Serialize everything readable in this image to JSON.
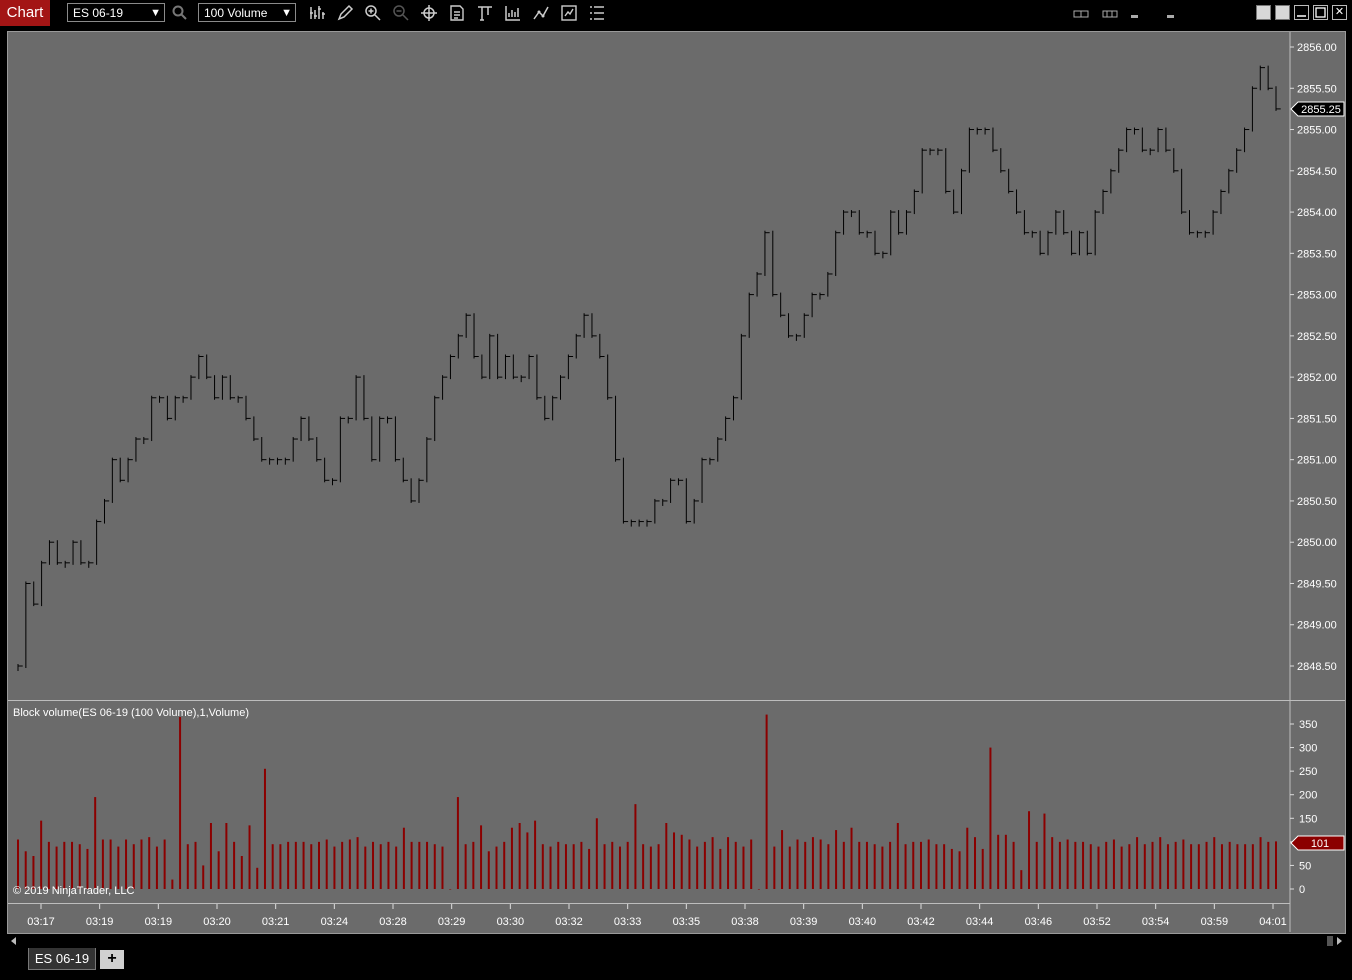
{
  "app": {
    "tab_label": "Chart"
  },
  "toolbar": {
    "instrument": "ES 06-19",
    "bar_type": "100 Volume",
    "icons": [
      "search-icon",
      "data-series-icon",
      "draw-tools-icon",
      "zoom-in-icon",
      "zoom-out-icon",
      "crosshair-icon",
      "chart-properties-icon",
      "bar-type-icon",
      "indicators-icon",
      "strategies-icon",
      "chart-trader-icon",
      "templates-icon"
    ]
  },
  "window_controls": {
    "close": "✕"
  },
  "price_panel": {
    "last_price_label": "2855.25",
    "y_axis_labels": [
      "2856.00",
      "2855.50",
      "2855.00",
      "2854.50",
      "2854.00",
      "2853.50",
      "2853.00",
      "2852.50",
      "2852.00",
      "2851.50",
      "2851.00",
      "2850.50",
      "2850.00",
      "2849.50",
      "2849.00",
      "2848.50"
    ]
  },
  "volume_panel": {
    "title": "Block volume(ES 06-19 (100 Volume),1,Volume)",
    "last_volume_label": "101",
    "y_axis_labels": [
      "350",
      "300",
      "250",
      "200",
      "150",
      "100",
      "50",
      "0"
    ]
  },
  "copyright": "© 2019 NinjaTrader, LLC",
  "x_axis_labels": [
    "03:17",
    "03:19",
    "03:19",
    "03:20",
    "03:21",
    "03:24",
    "03:28",
    "03:29",
    "03:30",
    "03:32",
    "03:33",
    "03:35",
    "03:38",
    "03:39",
    "03:40",
    "03:42",
    "03:44",
    "03:46",
    "03:52",
    "03:54",
    "03:59",
    "04:01"
  ],
  "colors": {
    "background": "#6b6b6b",
    "bar": "#000000",
    "volume": "#8b0000",
    "price_marker_bg": "#000000",
    "volume_marker_bg": "#8b0000"
  },
  "chart_data": {
    "type": "bar",
    "series": [
      {
        "name": "price",
        "values": [
          2848.5,
          2849.5,
          2849.25,
          2849.75,
          2850,
          2849.75,
          2849.75,
          2850,
          2849.75,
          2849.75,
          2850.25,
          2850.5,
          2851,
          2850.75,
          2851,
          2851.25,
          2851.25,
          2851.75,
          2851.75,
          2851.5,
          2851.75,
          2851.75,
          2852,
          2852.25,
          2852,
          2851.75,
          2852,
          2851.75,
          2851.75,
          2851.5,
          2851.25,
          2851,
          2851,
          2851,
          2851,
          2851.25,
          2851.5,
          2851.25,
          2851,
          2850.75,
          2850.75,
          2851.5,
          2851.5,
          2852,
          2851.5,
          2851,
          2851.5,
          2851.5,
          2851,
          2850.75,
          2850.5,
          2850.75,
          2851.25,
          2851.75,
          2852,
          2852.25,
          2852.5,
          2852.75,
          2852.25,
          2852,
          2852.5,
          2852,
          2852.25,
          2852,
          2852,
          2852.25,
          2851.75,
          2851.5,
          2851.75,
          2852,
          2852.25,
          2852.5,
          2852.75,
          2852.5,
          2852.25,
          2851.75,
          2851,
          2850.25,
          2850.25,
          2850.25,
          2850.25,
          2850.5,
          2850.5,
          2850.75,
          2850.75,
          2850.25,
          2850.5,
          2851,
          2851,
          2851.25,
          2851.5,
          2851.75,
          2852.5,
          2853,
          2853.25,
          2853.75,
          2853,
          2852.75,
          2852.5,
          2852.5,
          2852.75,
          2853,
          2853,
          2853.25,
          2853.75,
          2854,
          2854,
          2853.75,
          2853.75,
          2853.5,
          2853.5,
          2854,
          2853.75,
          2854,
          2854.25,
          2854.75,
          2854.75,
          2854.75,
          2854.25,
          2854,
          2854.5,
          2855,
          2855,
          2855,
          2854.75,
          2854.5,
          2854.25,
          2854,
          2853.75,
          2853.75,
          2853.5,
          2853.75,
          2854,
          2853.75,
          2853.5,
          2853.75,
          2853.5,
          2854,
          2854.25,
          2854.5,
          2854.75,
          2855,
          2855,
          2854.75,
          2854.75,
          2855,
          2854.75,
          2854.5,
          2854,
          2853.75,
          2853.75,
          2853.75,
          2854,
          2854.25,
          2854.5,
          2854.75,
          2855,
          2855.5,
          2855.75,
          2855.5,
          2855.25
        ]
      },
      {
        "name": "volume",
        "values": [
          105,
          80,
          70,
          145,
          100,
          90,
          100,
          100,
          95,
          85,
          195,
          105,
          105,
          90,
          105,
          95,
          105,
          110,
          90,
          105,
          20,
          365,
          95,
          100,
          50,
          140,
          80,
          140,
          100,
          70,
          135,
          45,
          255,
          95,
          95,
          100,
          100,
          100,
          95,
          100,
          105,
          90,
          100,
          105,
          110,
          90,
          100,
          95,
          100,
          90,
          130,
          100,
          100,
          100,
          95,
          90,
          0,
          195,
          95,
          100,
          135,
          80,
          90,
          100,
          130,
          140,
          120,
          145,
          95,
          90,
          100,
          95,
          95,
          100,
          85,
          150,
          95,
          100,
          90,
          100,
          180,
          95,
          90,
          95,
          140,
          120,
          115,
          105,
          90,
          100,
          110,
          85,
          110,
          100,
          90,
          105,
          0,
          370,
          90,
          125,
          90,
          105,
          100,
          110,
          105,
          95,
          125,
          100,
          130,
          100,
          100,
          95,
          90,
          100,
          140,
          95,
          100,
          100,
          105,
          95,
          95,
          85,
          80,
          130,
          110,
          85,
          300,
          115,
          115,
          100,
          40,
          165,
          100,
          160,
          110,
          100,
          105,
          100,
          100,
          95,
          90,
          100,
          105,
          90,
          95,
          110,
          95,
          100,
          110,
          95,
          100,
          105,
          95,
          95,
          100,
          110,
          95,
          100,
          95,
          95,
          95,
          110,
          100,
          101
        ]
      }
    ],
    "x": [
      "03:17",
      "03:19",
      "03:19",
      "03:20",
      "03:21",
      "03:24",
      "03:28",
      "03:29",
      "03:30",
      "03:32",
      "03:33",
      "03:35",
      "03:38",
      "03:39",
      "03:40",
      "03:42",
      "03:44",
      "03:46",
      "03:52",
      "03:54",
      "03:59",
      "04:01"
    ],
    "ylim_price": [
      2848.25,
      2856.25
    ],
    "ylim_volume": [
      0,
      380
    ],
    "grid": false
  }
}
